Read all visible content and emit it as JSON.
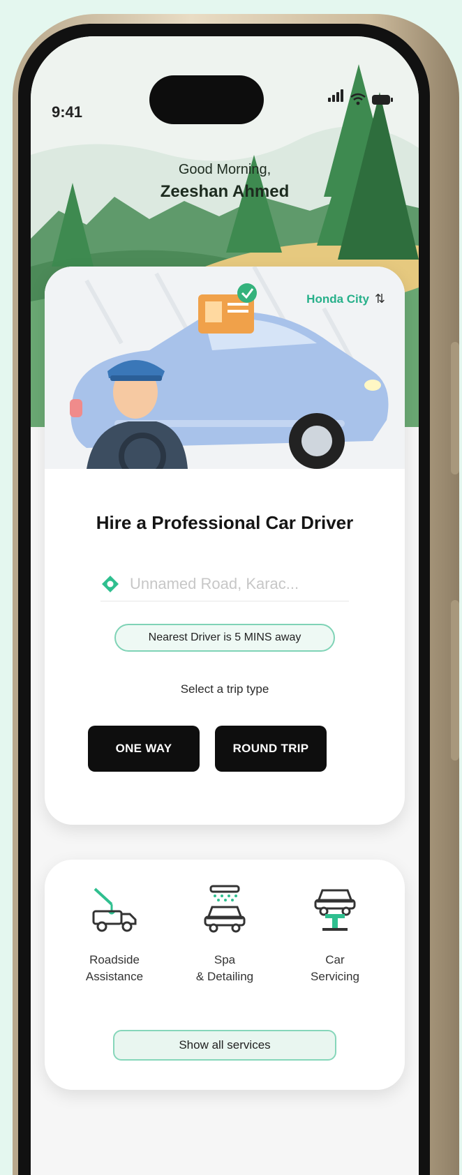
{
  "status_bar": {
    "time": "9:41"
  },
  "header": {
    "greeting": "Good Morning,",
    "user_name": "Zeeshan Ahmed"
  },
  "main_card": {
    "car_name": "Honda City",
    "title": "Hire a Professional Car Driver",
    "location_placeholder": "Unnamed Road, Karac...",
    "nearest_driver": "Nearest Driver is 5 MINS away",
    "trip_type_label": "Select a trip type",
    "one_way_label": "ONE WAY",
    "round_trip_label": "ROUND TRIP"
  },
  "services": {
    "items": [
      {
        "label": "Roadside\nAssistance",
        "icon": "tow-truck-icon"
      },
      {
        "label": "Spa\n& Detailing",
        "icon": "car-wash-icon"
      },
      {
        "label": "Car\nServicing",
        "icon": "car-lift-icon"
      }
    ],
    "show_all_label": "Show all services"
  },
  "colors": {
    "accent": "#27b08a",
    "pill_border": "#7fd3b6",
    "button_dark": "#0e0e0e",
    "background": "#e4f7ef"
  }
}
